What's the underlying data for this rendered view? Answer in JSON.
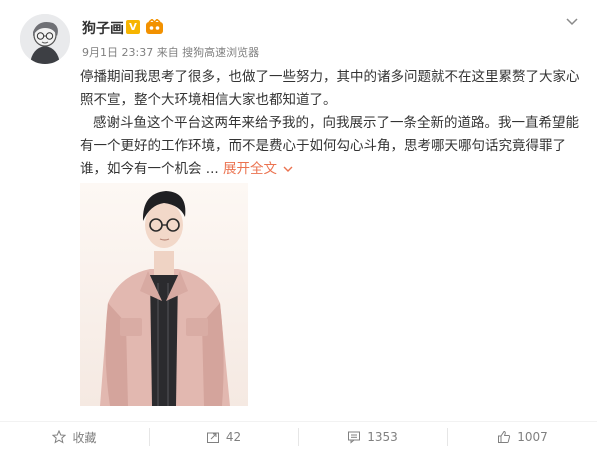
{
  "post": {
    "author": "狗子画",
    "vip_mark": "V",
    "meta": "9月1日 23:37 来自 搜狗高速浏览器",
    "paragraphs": [
      "停播期间我思考了很多，也做了一些努力，其中的诸多问题就不在这里累赘了大家心照不宣，整个大环境相信大家也都知道了。",
      "感谢斗鱼这个平台这两年来给予我的，向我展示了一条全新的道路。我一直希望能有一个更好的工作环境，而不是费心于如何勾心斗角，思考哪天哪句话究竟得罪了谁，如今有一个机会 ..."
    ],
    "expand_label": "展开全文"
  },
  "actions": {
    "favorite_label": "收藏",
    "repost_count": "42",
    "comment_count": "1353",
    "like_count": "1007"
  },
  "icons": [
    "more-chevron-icon",
    "star-icon",
    "repost-icon",
    "comment-icon",
    "like-icon"
  ],
  "colors": {
    "accent": "#eb7350",
    "muted": "#808080",
    "text": "#333333"
  }
}
